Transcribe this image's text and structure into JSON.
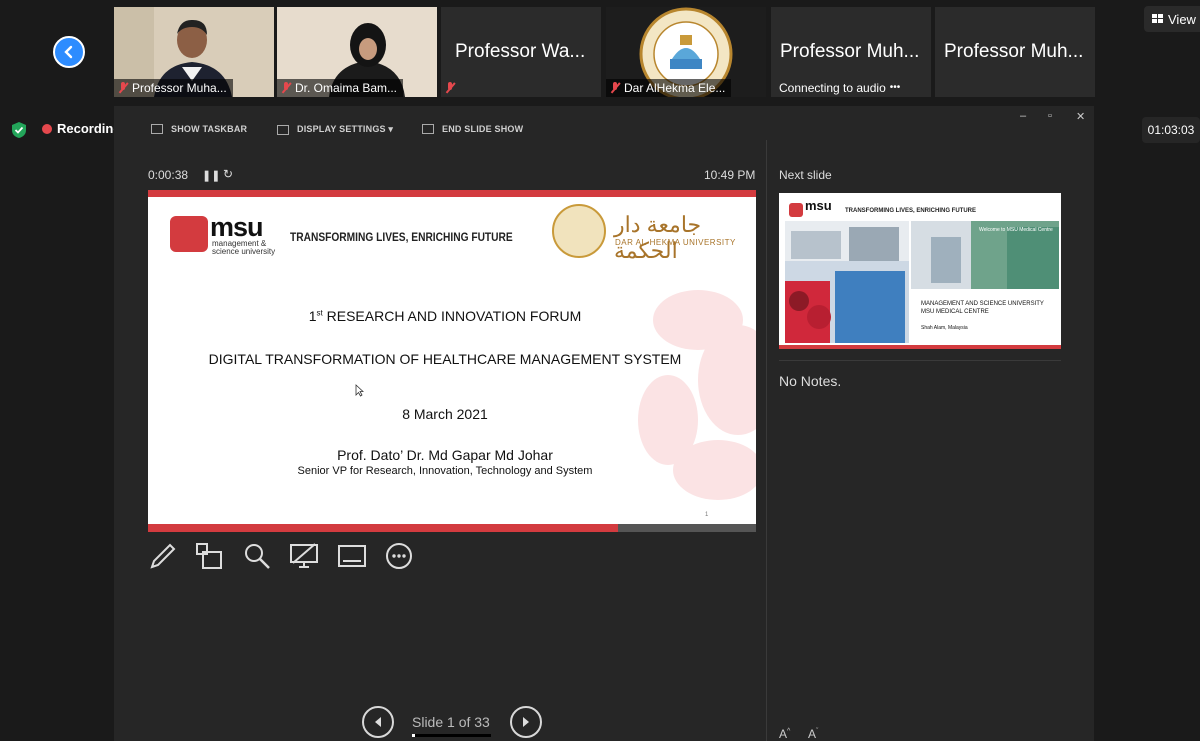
{
  "participants": [
    {
      "name": "Professor Muha...",
      "video": true
    },
    {
      "name": "Dr. Omaima Bam...",
      "video": true
    },
    {
      "name": "",
      "big_name": "Professor Wa...",
      "video": false
    },
    {
      "name": "Dar AlHekma Ele...",
      "video": true
    },
    {
      "name": "Connecting to audio",
      "big_name": "Professor Muh...",
      "video": false
    },
    {
      "name": "",
      "big_name": "Professor Muh...",
      "video": false
    }
  ],
  "top": {
    "view_label": "View"
  },
  "recording": {
    "label": "Recording",
    "timer": "01:03:03"
  },
  "toolbar": {
    "show_taskbar": "SHOW TASKBAR",
    "display_settings": "DISPLAY SETTINGS ▾",
    "end_show": "END SLIDE SHOW"
  },
  "presenter": {
    "elapsed": "0:00:38",
    "clock": "10:49 PM",
    "slide_counter": "Slide 1 of 33",
    "next_label": "Next slide",
    "notes": "No Notes."
  },
  "slide": {
    "msu_name": "msu",
    "msu_sub": "management &\nscience university",
    "tagline": "TRANSFORMING LIVES, ENRICHING FUTURE",
    "dah_arabic": "جامعة دار الحكمة",
    "dah_english": "DAR AL-HEKMA UNIVERSITY",
    "forum_prefix": "1",
    "forum_sup": "st",
    "forum_title": " RESEARCH AND INNOVATION FORUM",
    "main_title": "DIGITAL TRANSFORMATION OF HEALTHCARE MANAGEMENT SYSTEM",
    "date": "8 March 2021",
    "speaker": "Prof. Dato’ Dr. Md Gapar Md Johar",
    "speaker_role": "Senior VP for Research, Innovation, Technology and System",
    "page_num": "1"
  },
  "next_slide": {
    "msu_name": "msu",
    "tagline": "TRANSFORMING LIVES, ENRICHING FUTURE",
    "line1": "MANAGEMENT AND SCIENCE UNIVERSITY",
    "line2": "MSU MEDICAL CENTRE",
    "location": "Shah Alam, Malaysia",
    "welcome": "Welcome to MSU Medical Centre"
  }
}
